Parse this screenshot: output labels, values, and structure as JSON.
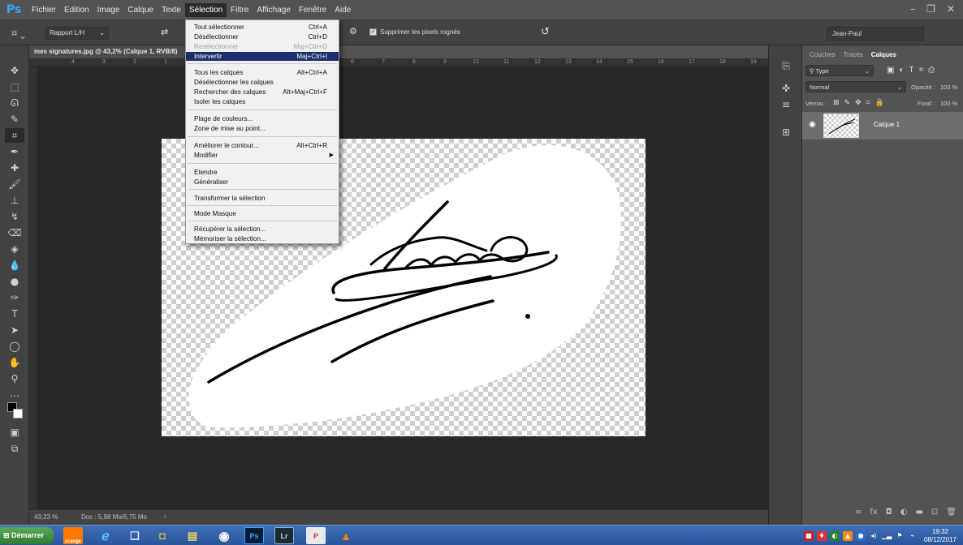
{
  "app": {
    "logo": "Ps",
    "menus": [
      "Fichier",
      "Edition",
      "Image",
      "Calque",
      "Texte",
      "Sélection",
      "Filtre",
      "Affichage",
      "Fenêtre",
      "Aide"
    ],
    "active_menu": "Sélection"
  },
  "options_bar": {
    "ratio_select": "Rapport L/H",
    "delete_cropped_label": "Supprimer les pixels rognés",
    "workspace": "Jean-Paul"
  },
  "document": {
    "tab_title": "mes signatures.jpg @ 43,2% (Calque 1, RVB/8)",
    "ruler_marks": [
      "4",
      "3",
      "2",
      "1",
      "0",
      "6",
      "7",
      "8",
      "9",
      "10",
      "11",
      "12",
      "13",
      "14",
      "15",
      "16",
      "17",
      "18",
      "19"
    ],
    "zoom": "43,23 %",
    "doc_size": "Doc : 5,98 Mo/6,75 Mo"
  },
  "selection_menu": {
    "items": [
      {
        "label": "Tout sélectionner",
        "shortcut": "Ctrl+A"
      },
      {
        "label": "Désélectionner",
        "shortcut": "Ctrl+D"
      },
      {
        "label": "Resélectionner",
        "shortcut": "Maj+Ctrl+D",
        "disabled": true
      },
      {
        "label": "Intervertir",
        "shortcut": "Maj+Ctrl+I",
        "highlighted": true
      },
      {
        "separator": true
      },
      {
        "label": "Tous les calques",
        "shortcut": "Alt+Ctrl+A"
      },
      {
        "label": "Désélectionner les calques",
        "shortcut": ""
      },
      {
        "label": "Rechercher des calques",
        "shortcut": "Alt+Maj+Ctrl+F"
      },
      {
        "label": "Isoler les calques",
        "shortcut": ""
      },
      {
        "separator": true
      },
      {
        "label": "Plage de couleurs...",
        "shortcut": ""
      },
      {
        "label": "Zone de mise au point...",
        "shortcut": ""
      },
      {
        "separator": true
      },
      {
        "label": "Améliorer le contour...",
        "shortcut": "Alt+Ctrl+R"
      },
      {
        "label": "Modifier",
        "shortcut": "",
        "submenu": true
      },
      {
        "separator": true
      },
      {
        "label": "Etendre",
        "shortcut": ""
      },
      {
        "label": "Généraliser",
        "shortcut": ""
      },
      {
        "separator": true
      },
      {
        "label": "Transformer la sélection",
        "shortcut": ""
      },
      {
        "separator": true
      },
      {
        "label": "Mode Masque",
        "shortcut": ""
      },
      {
        "separator": true
      },
      {
        "label": "Récupérer la sélection...",
        "shortcut": ""
      },
      {
        "label": "Mémoriser la sélection...",
        "shortcut": ""
      }
    ]
  },
  "layers_panel": {
    "tabs": [
      "Couches",
      "Tracés",
      "Calques"
    ],
    "active_tab": "Calques",
    "filter": "Type",
    "blend_mode": "Normal",
    "opacity_label": "Opacité :",
    "opacity": "100 %",
    "lock_label": "Verrou :",
    "fill_label": "Fond :",
    "fill": "100 %",
    "layer_name": "Calque 1"
  },
  "taskbar": {
    "start_label": "Démarrer",
    "apps": [
      "orange",
      "Ps",
      "Lr"
    ],
    "time": "19:32",
    "date": "08/12/2017"
  },
  "colors": {
    "ps_blue": "#31a8ff",
    "menu_highlight": "#1b2f6b",
    "workspace_bg": "#282828"
  }
}
